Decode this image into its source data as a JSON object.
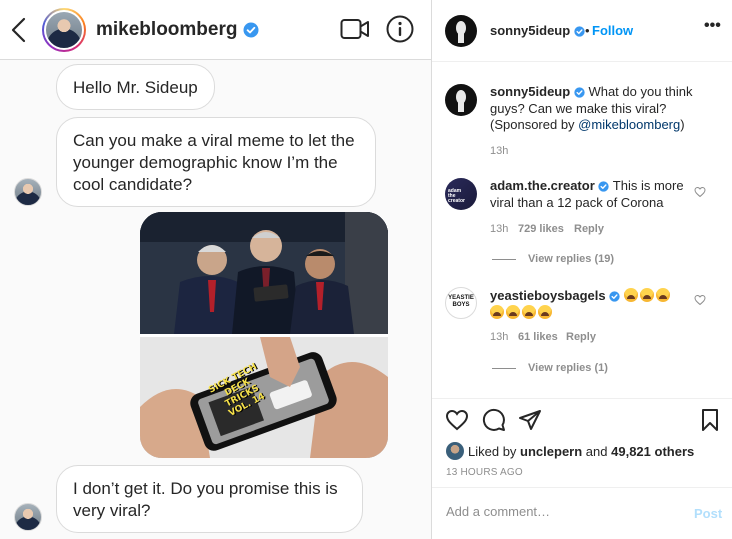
{
  "dm": {
    "username": "mikebloomberg",
    "messages": [
      "Hello Mr. Sideup",
      "Can you make a viral meme to let the younger demographic know I’m the cool candidate?",
      "I don’t get it. Do you promise this is very viral?"
    ],
    "meme_caption": "SICK TECH DECK TRICKS VOL. 14"
  },
  "post": {
    "username": "sonny5ideup",
    "dot": "•",
    "follow": "Follow",
    "more": "•••",
    "caption": {
      "user": "sonny5ideup",
      "text": "What do you think guys? Can we make this viral? (Sponsored by ",
      "mention": "@mikebloomberg",
      "close": ")",
      "time": "13h"
    },
    "comments": [
      {
        "user": "adam.the.creator",
        "text": "This is more viral than a 12 pack of Corona",
        "time": "13h",
        "likes": "729 likes",
        "reply": "Reply",
        "view_replies": "View replies (19)"
      },
      {
        "user": "yeastieboysbagels",
        "emoji_count": 7,
        "time": "13h",
        "likes": "61 likes",
        "reply": "Reply",
        "view_replies": "View replies (1)"
      }
    ],
    "liked_by_prefix": "Liked by",
    "liked_by_user": "unclepern",
    "liked_by_and": "and",
    "liked_by_count": "49,821 others",
    "post_time": "13 HOURS AGO",
    "comment_placeholder": "Add a comment…",
    "post_button": "Post"
  },
  "colors": {
    "verified": "#3897f0",
    "follow": "#0095f6",
    "post_disabled": "#b2dffc"
  }
}
